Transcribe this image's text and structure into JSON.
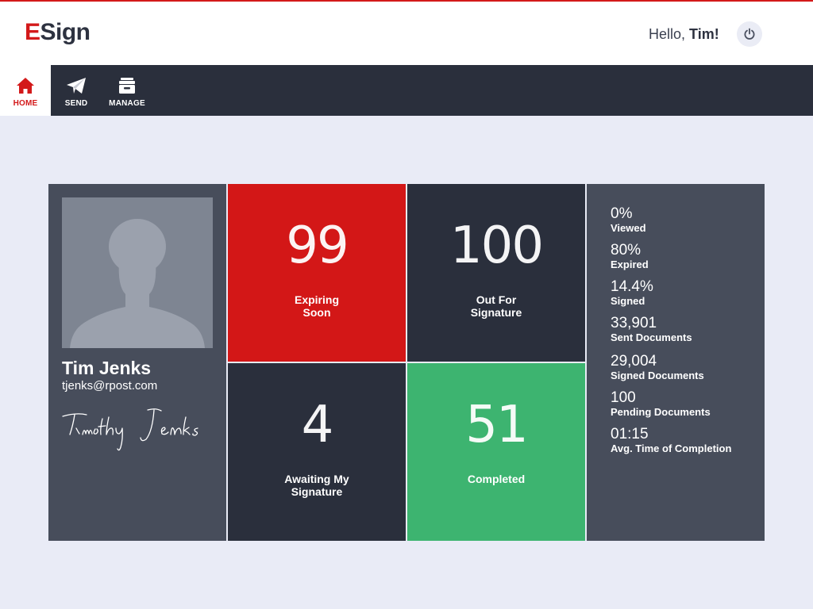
{
  "app": {
    "logo_first": "E",
    "logo_rest": "Sign",
    "greeting_prefix": "Hello,",
    "greeting_name": "Tim!",
    "brand_color": "#d3191a"
  },
  "nav": {
    "items": [
      {
        "label": "HOME",
        "icon": "home-icon",
        "active": true
      },
      {
        "label": "SEND",
        "icon": "paper-plane-icon",
        "active": false
      },
      {
        "label": "MANAGE",
        "icon": "archive-box-icon",
        "active": false
      }
    ]
  },
  "profile": {
    "name": "Tim Jenks",
    "email": "tjenks@rpost.com",
    "signature": "Timothy Jenks"
  },
  "tiles": {
    "expiring": {
      "value": "99",
      "label": "Expiring\nSoon",
      "color": "#d31717"
    },
    "out_for_signature": {
      "value": "100",
      "label": "Out For\nSignature",
      "color": "#2a2f3c"
    },
    "awaiting": {
      "value": "4",
      "label": "Awaiting My\nSignature",
      "color": "#2a2f3c"
    },
    "completed": {
      "value": "51",
      "label": "Completed",
      "color": "#3db470"
    }
  },
  "stats": [
    {
      "value": "0%",
      "label": "Viewed"
    },
    {
      "value": "80%",
      "label": "Expired"
    },
    {
      "value": "14.4%",
      "label": "Signed"
    },
    {
      "value": "33,901",
      "label": "Sent Documents"
    },
    {
      "value": "29,004",
      "label": "Signed Documents"
    },
    {
      "value": "100",
      "label": "Pending Documents"
    },
    {
      "value": "01:15",
      "label": "Avg. Time of Completion"
    }
  ]
}
